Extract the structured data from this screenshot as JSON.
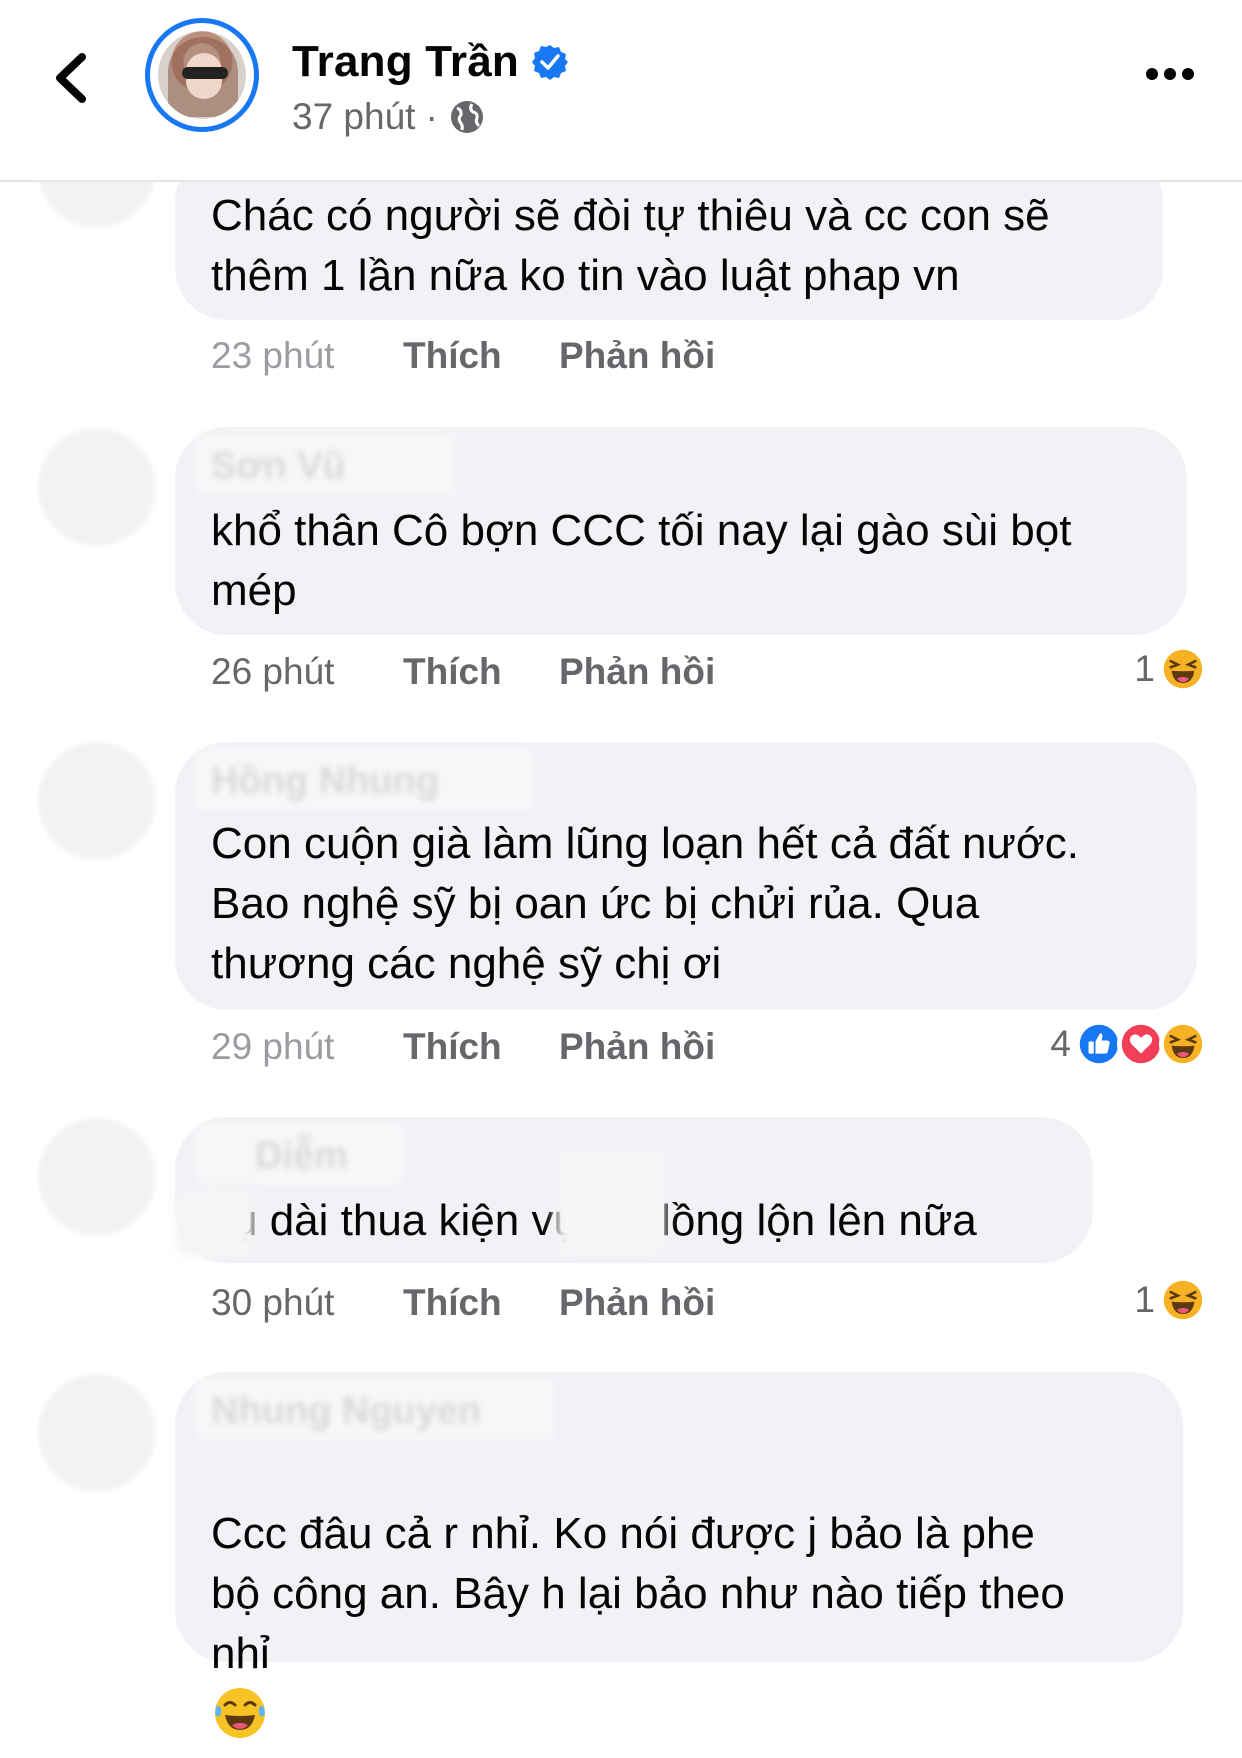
{
  "header": {
    "name": "Trang Trần",
    "time": "37 phút",
    "separator": "·",
    "audience_icon": "globe-icon",
    "back_icon": "chevron-left-icon",
    "more_icon": "more-horizontal-icon",
    "verified_icon": "verified-badge-icon"
  },
  "colors": {
    "accent": "#1877f2",
    "bubble": "#f0f2f5",
    "secondary_text": "#65676b",
    "love": "#f33e58",
    "haha": "#f7b125"
  },
  "comments": [
    {
      "author": "",
      "text": "Chác có người sẽ đòi tự thiêu và cc con sẽ\nthêm 1 lần nữa ko tin vào luật phap vn",
      "time": "23 phút",
      "like": "Thích",
      "reply": "Phản hồi",
      "reaction_count": "",
      "reactions": []
    },
    {
      "author": "Sơn Vũ",
      "text": "khổ thân Cô bợn CCC tối nay lại gào sùi bọt\nmép",
      "time": "26 phút",
      "like": "Thích",
      "reply": "Phản hồi",
      "reaction_count": "1",
      "reactions": [
        "haha-icon"
      ]
    },
    {
      "author": "Hồng Nhung",
      "text": "Con cuộn già làm lũng loạn hết cả đất nước.\nBao nghệ sỹ bị oan ức bị chửi rủa. Qua\nthương các nghệ sỹ chị ơi",
      "time": "29 phút",
      "like": "Thích",
      "reply": "Phản hồi",
      "reaction_count": "4",
      "reactions": [
        "like-icon",
        "love-icon",
        "haha-icon"
      ]
    },
    {
      "author": "Diễm",
      "text": "vụ dài thua kiện vụ dài lồng lộn lên nữa",
      "time": "30 phút",
      "like": "Thích",
      "reply": "Phản hồi",
      "reaction_count": "1",
      "reactions": [
        "haha-icon"
      ]
    },
    {
      "author": "Nhung Nguyen",
      "text": "Ccc đâu cả r nhỉ. Ko nói được j bảo là phe\nbộ công an. Bây h lại bảo như nào tiếp theo\nnhỉ",
      "time": "",
      "like": "",
      "reply": "",
      "reaction_count": "",
      "reactions": [],
      "inline_emoji": "tears-of-joy-icon"
    }
  ]
}
